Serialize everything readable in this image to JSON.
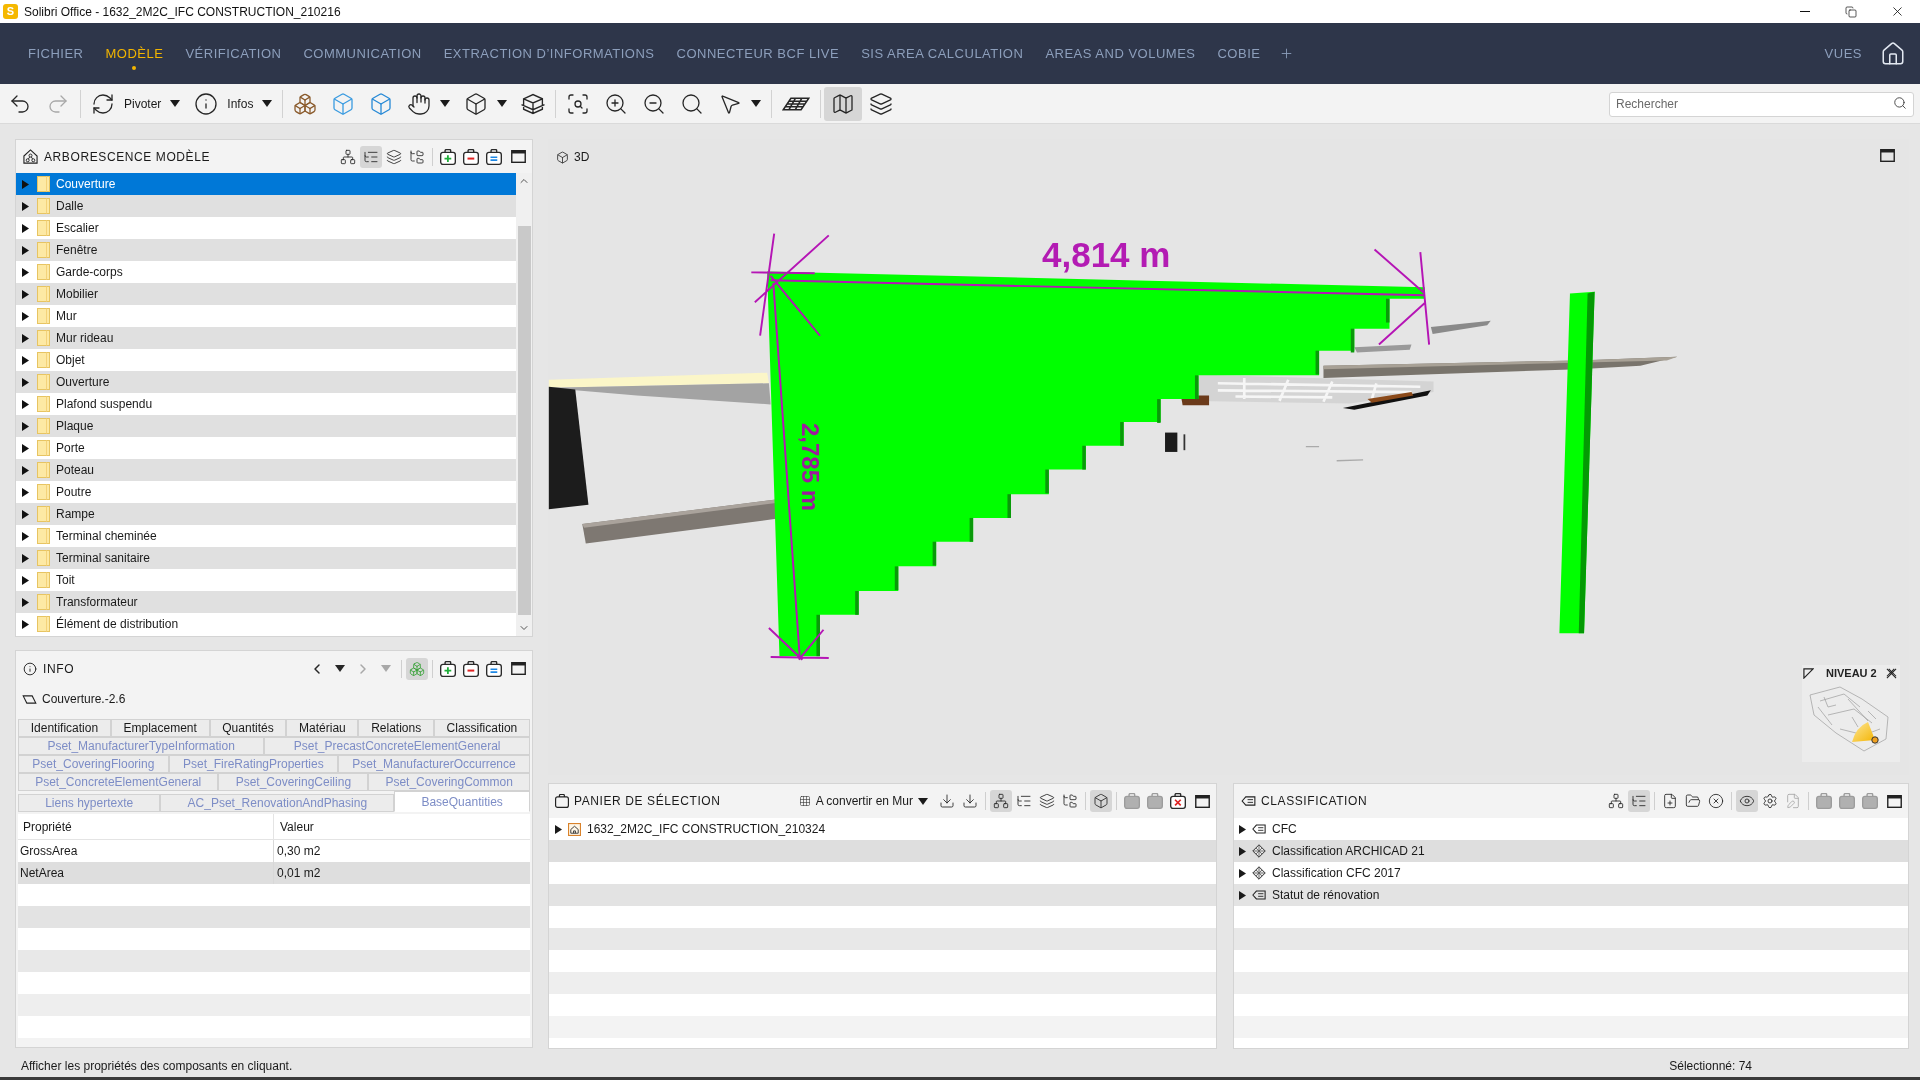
{
  "window": {
    "logo": "S",
    "title": "Solibri Office - 1632_2M2C_IFC CONSTRUCTION_210216"
  },
  "ribbon_tabs": [
    {
      "label": "FICHIER",
      "selected": false
    },
    {
      "label": "MODÈLE",
      "selected": true
    },
    {
      "label": "VÉRIFICATION",
      "selected": false
    },
    {
      "label": "COMMUNICATION",
      "selected": false
    },
    {
      "label": "EXTRACTION D’INFORMATIONS",
      "selected": false
    },
    {
      "label": "CONNECTEUR BCF LIVE",
      "selected": false
    },
    {
      "label": "SIS AREA CALCULATION",
      "selected": false
    },
    {
      "label": "AREAS AND VOLUMES",
      "selected": false
    },
    {
      "label": "COBIE",
      "selected": false
    }
  ],
  "views_menu": "VUES",
  "toolbar": {
    "groups": [
      [
        {
          "kind": "undo",
          "pressed": false,
          "disabled": false
        },
        {
          "kind": "redo",
          "pressed": false,
          "disabled": true
        }
      ],
      [
        {
          "kind": "rotate",
          "label": "Pivoter",
          "dropdown": true,
          "pressed": false,
          "disabled": false
        },
        {
          "kind": "info",
          "label": "Infos",
          "dropdown": true,
          "pressed": false,
          "disabled": false
        }
      ],
      [
        {
          "kind": "cubes",
          "pressed": false,
          "disabled": false
        },
        {
          "kind": "wirecube",
          "pressed": false,
          "disabled": false
        },
        {
          "kind": "ghostcube",
          "pressed": false,
          "disabled": false
        },
        {
          "kind": "hand",
          "dropdown": true,
          "pressed": false,
          "disabled": false
        },
        {
          "kind": "cube",
          "dropdown": true,
          "pressed": false,
          "disabled": false
        },
        {
          "kind": "section",
          "pressed": false,
          "disabled": false
        }
      ],
      [
        {
          "kind": "zoomall",
          "pressed": false,
          "disabled": false
        },
        {
          "kind": "zoomin",
          "pressed": false,
          "disabled": false
        },
        {
          "kind": "zoomout",
          "pressed": false,
          "disabled": false
        },
        {
          "kind": "zoomsel",
          "pressed": false,
          "disabled": false
        },
        {
          "kind": "pick",
          "dropdown": true,
          "pressed": false,
          "disabled": false
        }
      ],
      [
        {
          "kind": "grid",
          "pressed": false,
          "disabled": false
        }
      ],
      [
        {
          "kind": "map",
          "pressed": true,
          "disabled": false
        },
        {
          "kind": "layers",
          "pressed": false,
          "disabled": false
        }
      ]
    ],
    "search": {
      "placeholder": "Rechercher"
    }
  },
  "model_tree": {
    "title": "ARBORESCENCE MODÈLE",
    "tool_groups": [
      [
        {
          "kind": "hierarchy",
          "pressed": false
        },
        {
          "kind": "tree",
          "pressed": true
        },
        {
          "kind": "layertree",
          "pressed": false
        },
        {
          "kind": "filter",
          "pressed": false
        }
      ],
      [
        {
          "kind": "add",
          "pressed": false
        },
        {
          "kind": "remove",
          "pressed": false
        },
        {
          "kind": "replace",
          "pressed": false
        }
      ]
    ],
    "items": [
      {
        "label": "Couverture",
        "selected": true,
        "expanded": false
      },
      {
        "label": "Dalle",
        "selected": false,
        "expanded": false
      },
      {
        "label": "Escalier",
        "selected": false,
        "expanded": false
      },
      {
        "label": "Fenêtre",
        "selected": false,
        "expanded": false
      },
      {
        "label": "Garde-corps",
        "selected": false,
        "expanded": false
      },
      {
        "label": "Mobilier",
        "selected": false,
        "expanded": false
      },
      {
        "label": "Mur",
        "selected": false,
        "expanded": false
      },
      {
        "label": "Mur rideau",
        "selected": false,
        "expanded": false
      },
      {
        "label": "Objet",
        "selected": false,
        "expanded": false
      },
      {
        "label": "Ouverture",
        "selected": false,
        "expanded": false
      },
      {
        "label": "Plafond suspendu",
        "selected": false,
        "expanded": false
      },
      {
        "label": "Plaque",
        "selected": false,
        "expanded": false
      },
      {
        "label": "Porte",
        "selected": false,
        "expanded": false
      },
      {
        "label": "Poteau",
        "selected": false,
        "expanded": false
      },
      {
        "label": "Poutre",
        "selected": false,
        "expanded": false
      },
      {
        "label": "Rampe",
        "selected": false,
        "expanded": false
      },
      {
        "label": "Terminal cheminée",
        "selected": false,
        "expanded": false
      },
      {
        "label": "Terminal sanitaire",
        "selected": false,
        "expanded": false
      },
      {
        "label": "Toit",
        "selected": false,
        "expanded": false
      },
      {
        "label": "Transformateur",
        "selected": false,
        "expanded": false
      },
      {
        "label": "Élément de distribution",
        "selected": false,
        "expanded": false
      }
    ]
  },
  "info": {
    "title": "INFO",
    "tool_groups": [
      [
        {
          "kind": "back",
          "pressed": false,
          "disabled": false
        },
        {
          "kind": "menu",
          "pressed": false,
          "disabled": false
        },
        {
          "kind": "forward",
          "pressed": false,
          "disabled": true
        },
        {
          "kind": "menu",
          "pressed": false,
          "disabled": true
        }
      ],
      [
        {
          "kind": "highlight",
          "pressed": true,
          "disabled": false
        }
      ],
      [
        {
          "kind": "add",
          "pressed": false,
          "disabled": false
        },
        {
          "kind": "remove",
          "pressed": false,
          "disabled": false
        },
        {
          "kind": "replace",
          "pressed": false,
          "disabled": false
        }
      ]
    ],
    "component": "Couverture.-2.6",
    "tab_rows": [
      [
        {
          "label": "Identification",
          "kind": "standard",
          "selected": false
        },
        {
          "label": "Emplacement",
          "kind": "standard",
          "selected": false
        },
        {
          "label": "Quantités",
          "kind": "standard",
          "selected": false
        },
        {
          "label": "Matériau",
          "kind": "standard",
          "selected": false
        },
        {
          "label": "Relations",
          "kind": "standard",
          "selected": false
        },
        {
          "label": "Classification",
          "kind": "standard",
          "selected": false
        }
      ],
      [
        {
          "label": "Pset_ManufacturerTypeInformation",
          "kind": "pset",
          "selected": false
        },
        {
          "label": "Pset_PrecastConcreteElementGeneral",
          "kind": "pset",
          "selected": false
        }
      ],
      [
        {
          "label": "Pset_CoveringFlooring",
          "kind": "pset",
          "selected": false
        },
        {
          "label": "Pset_FireRatingProperties",
          "kind": "pset",
          "selected": false
        },
        {
          "label": "Pset_ManufacturerOccurrence",
          "kind": "pset",
          "selected": false
        }
      ],
      [
        {
          "label": "Pset_ConcreteElementGeneral",
          "kind": "pset",
          "selected": false
        },
        {
          "label": "Pset_CoveringCeiling",
          "kind": "pset",
          "selected": false
        },
        {
          "label": "Pset_CoveringCommon",
          "kind": "pset",
          "selected": false
        }
      ],
      [
        {
          "label": "Liens hypertexte",
          "kind": "pset",
          "selected": false
        },
        {
          "label": "AC_Pset_RenovationAndPhasing",
          "kind": "pset",
          "selected": false
        },
        {
          "label": "BaseQuantities",
          "kind": "pset",
          "selected": true
        }
      ]
    ],
    "table": {
      "columns": [
        "Propriété",
        "Valeur"
      ],
      "rows": [
        [
          "GrossArea",
          "0,30 m2"
        ],
        [
          "NetArea",
          "0,01 m2"
        ]
      ]
    }
  },
  "viewport": {
    "title": "3D",
    "dimension_width": "4,814 m",
    "dimension_height": "2,785 m",
    "level_map": {
      "title": "NIVEAU 2"
    }
  },
  "selection_basket": {
    "title": "PANIER DE SÉLECTION",
    "rule": "A convertir en Mur",
    "tool_groups": [
      [
        {
          "kind": "download",
          "pressed": false,
          "disabled": false
        },
        {
          "kind": "download",
          "pressed": false,
          "disabled": false
        }
      ],
      [
        {
          "kind": "hierarchy",
          "pressed": true,
          "disabled": false
        },
        {
          "kind": "tree",
          "pressed": false,
          "disabled": false
        },
        {
          "kind": "layertree",
          "pressed": false,
          "disabled": false
        },
        {
          "kind": "filter",
          "pressed": false,
          "disabled": false
        }
      ],
      [
        {
          "kind": "cube",
          "pressed": true,
          "disabled": false
        }
      ],
      [
        {
          "kind": "remove",
          "pressed": false,
          "disabled": true
        },
        {
          "kind": "replace",
          "pressed": false,
          "disabled": true
        },
        {
          "kind": "clear",
          "pressed": false,
          "disabled": false
        }
      ]
    ],
    "items": [
      {
        "label": "1632_2M2C_IFC CONSTRUCTION_210324",
        "expanded": false
      }
    ]
  },
  "classification": {
    "title": "CLASSIFICATION",
    "tool_groups": [
      [
        {
          "kind": "hierarchy",
          "pressed": false,
          "disabled": false
        },
        {
          "kind": "tree",
          "pressed": true,
          "disabled": false
        }
      ],
      [
        {
          "kind": "newfile",
          "pressed": false,
          "disabled": false
        },
        {
          "kind": "open",
          "pressed": false,
          "disabled": false
        },
        {
          "kind": "close",
          "pressed": false,
          "disabled": false
        }
      ],
      [
        {
          "kind": "eye",
          "pressed": true,
          "disabled": false
        },
        {
          "kind": "settings",
          "pressed": false,
          "disabled": false
        },
        {
          "kind": "edit",
          "pressed": false,
          "disabled": true
        }
      ],
      [
        {
          "kind": "add",
          "pressed": false,
          "disabled": true
        },
        {
          "kind": "remove",
          "pressed": false,
          "disabled": true
        },
        {
          "kind": "replace",
          "pressed": false,
          "disabled": true
        }
      ]
    ],
    "items": [
      {
        "label": "CFC",
        "kind": "tag",
        "expanded": false
      },
      {
        "label": "Classification ARCHICAD 21",
        "kind": "scheme",
        "expanded": false
      },
      {
        "label": "Classification CFC 2017",
        "kind": "scheme",
        "expanded": false
      },
      {
        "label": "Statut de rénovation",
        "kind": "tag",
        "expanded": false
      }
    ]
  },
  "status_bar": {
    "hint": "Afficher les propriétés des composants en cliquant.",
    "selection": "Sélectionné: 74"
  }
}
